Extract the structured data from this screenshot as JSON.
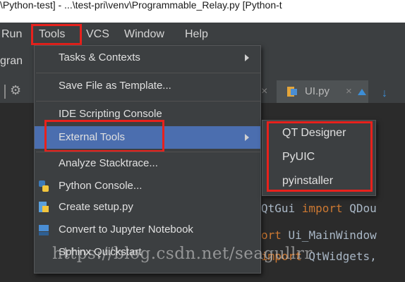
{
  "window": {
    "title": "\\Python-test] - ...\\test-pri\\venv\\Programmable_Relay.py [Python-t"
  },
  "menubar": {
    "items": [
      "Run",
      "Tools",
      "VCS",
      "Window",
      "Help"
    ]
  },
  "background": {
    "toolbar_fragment": "gran",
    "tabs": [
      "UI.py"
    ],
    "code_lines": [
      {
        "prefix": "QtGui ",
        "kw": "import",
        "suffix": " QDou"
      },
      {
        "prefix": "",
        "kw": "ort",
        "suffix": " Ui_MainWindow"
      },
      {
        "prefix": "",
        "kw": "import",
        "suffix": " QtWidgets,"
      }
    ]
  },
  "tools_menu": {
    "items": [
      {
        "label": "Tasks & Contexts",
        "has_submenu": true
      },
      {
        "label": "Save File as Template...",
        "has_submenu": false
      },
      {
        "label": "IDE Scripting Console",
        "has_submenu": false
      },
      {
        "label": "External Tools",
        "has_submenu": true,
        "highlighted": true
      },
      {
        "label": "Analyze Stacktrace...",
        "has_submenu": false
      },
      {
        "label": "Python Console...",
        "icon": "python-icon"
      },
      {
        "label": "Create setup.py",
        "icon": "python-file-icon"
      },
      {
        "label": "Convert to Jupyter Notebook",
        "icon": "notebook-icon"
      },
      {
        "label": "Sphinx Quickstart",
        "has_submenu": false
      }
    ]
  },
  "external_tools_submenu": {
    "items": [
      "QT Designer",
      "PyUIC",
      "pyinstaller"
    ]
  },
  "watermark": "https://blog.csdn.net/seagullrr",
  "colors": {
    "highlight_box": "#e8211c",
    "menu_bg": "#3c3f41",
    "selection": "#4b6eaf",
    "keyword": "#cc7832"
  }
}
